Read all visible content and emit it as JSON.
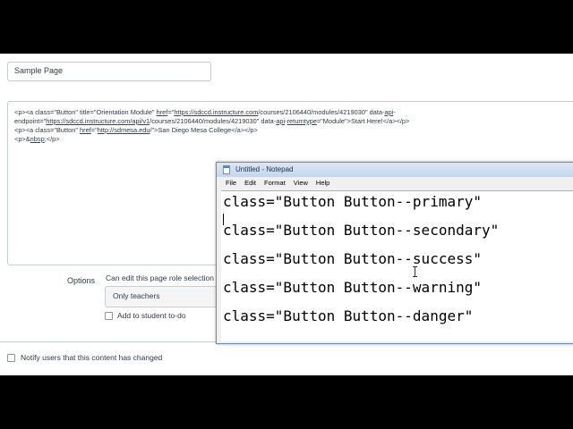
{
  "page_title_input": "Sample Page",
  "editor": {
    "line1a": "<p><a class=\"Button\" title=\"Orientation Module\" ",
    "line1b": "href",
    "line1c": "=\"",
    "line1d": "https://sdccd.instructure.com",
    "line1e": "/courses/2106440/modules/4219030\" data-",
    "line1f": "api",
    "line1g": "-",
    "line2a": "endpoint=\"",
    "line2b": "https://sdccd.instructure.com/api/v1",
    "line2c": "/courses/2106440/modules/4219030\" data-",
    "line2d": "api",
    "line2e": "-",
    "line2f": "returntype",
    "line2g": "=\"Module\">Start Here!</a></p>",
    "line3a": "<p><a class=\"Button\" ",
    "line3b": "href",
    "line3c": "=\"",
    "line3d": "http://sdmesa.edu",
    "line3e": "/\">San Diego Mesa College</a></p>",
    "line4a": "<p>&",
    "line4b": "nbsp",
    "line4c": ";</p>"
  },
  "options": {
    "label": "Options",
    "can_edit_label": "Can edit this page role selection",
    "role_selected": "Only teachers",
    "add_todo": "Add to student to-do"
  },
  "notify": "Notify users that this content has changed",
  "notepad": {
    "title": "Untitled - Notepad",
    "menu": [
      "File",
      "Edit",
      "Format",
      "View",
      "Help"
    ],
    "lines": [
      "class=\"Button Button--primary\"",
      "class=\"Button Button--secondary\"",
      "class=\"Button Button--success\"",
      "class=\"Button Button--warning\"",
      "class=\"Button Button--danger\""
    ]
  }
}
